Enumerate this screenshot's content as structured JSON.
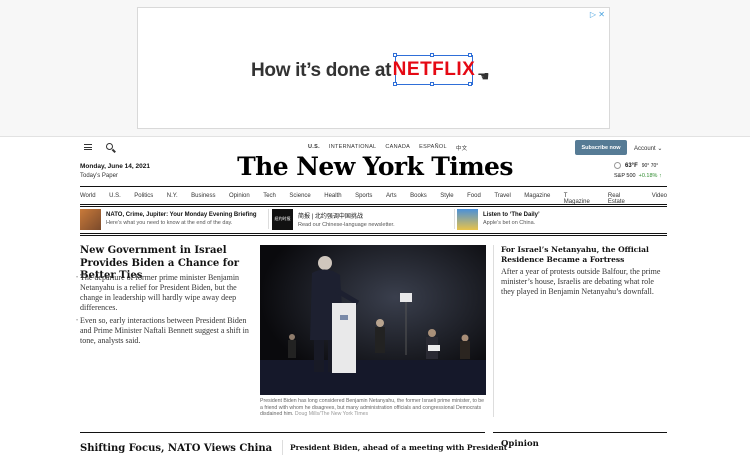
{
  "ad": {
    "choices": "▷ ✕",
    "text": "How it’s done at",
    "brand": "NETFLIX"
  },
  "topbar": {
    "editions": [
      "U.S.",
      "INTERNATIONAL",
      "CANADA",
      "ESPAÑOL",
      "中文"
    ],
    "subscribe_label": "Subscribe now",
    "account_label": "Account ⌄"
  },
  "masthead": {
    "date": "Monday, June 14, 2021",
    "todays_paper": "Today’s Paper",
    "logo": "The New York Times",
    "weather": {
      "temp": "63°F",
      "high_low": "90° 70°"
    },
    "stock": {
      "name": "S&P 500",
      "change": "+0.18% ↑"
    }
  },
  "nav": {
    "sections": [
      "World",
      "U.S.",
      "Politics",
      "N.Y.",
      "Business",
      "Opinion",
      "Tech",
      "Science",
      "Health",
      "Sports",
      "Arts",
      "Books",
      "Style",
      "Food",
      "Travel",
      "Magazine",
      "T Magazine",
      "Real Estate",
      "Video"
    ]
  },
  "briefings": [
    {
      "title": "NATO, Crime, Jupiter: Your Monday Evening Briefing",
      "sub": "Here’s what you need to know at the end of the day."
    },
    {
      "title": "简报 | 北约强调中国挑战",
      "sub": "Read our Chinese-language newsletter."
    },
    {
      "title": "Listen to ‘The Daily’",
      "sub": "Apple’s bet on China."
    }
  ],
  "lead": {
    "headline": "New Government in Israel Provides Biden a Chance for Better Ties",
    "bullets": [
      "The departure of former prime minister Benjamin Netanyahu is a relief for President Biden, but the change in leadership will hardly wipe away deep differences.",
      "Even so, early interactions between President Biden and Prime Minister Naftali Bennett suggest a shift in tone, analysts said."
    ]
  },
  "photo": {
    "caption": "President Biden has long considered Benjamin Netanyahu, the former Israeli prime minister, to be a friend with whom he disagrees, but many administration officials and congressional Democrats disdained him.",
    "credit": "Doug Mills/The New York Times"
  },
  "right_story": {
    "headline": "For Israel’s Netanyahu, the Official Residence Became a Fortress",
    "body": "After a year of protests outside Balfour, the prime minister’s house, Israelis are debating what role they played in Benjamin Netanyahu’s downfall."
  },
  "lower": {
    "left_headline": "Shifting Focus, NATO Views China",
    "mid_headline": "President Biden, ahead of a meeting with President",
    "opinion_label": "Opinion"
  },
  "colors": {
    "subscribe_bg": "#567b95",
    "netflix_red": "#e50914",
    "up_green": "#2d8a2d"
  }
}
